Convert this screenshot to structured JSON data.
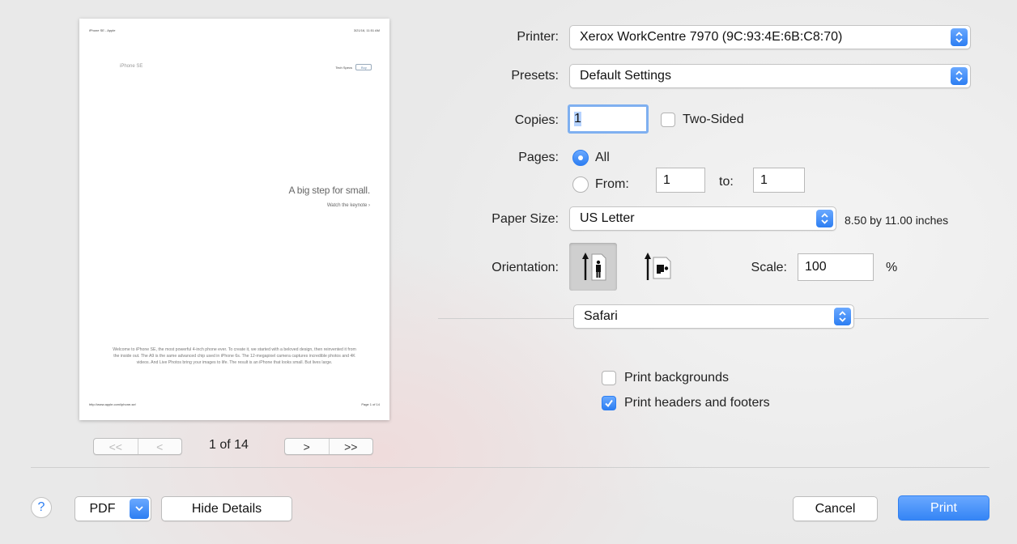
{
  "preview": {
    "header_left": "iPhone SE - Apple",
    "header_right": "3/21/16, 11:51 AM",
    "logo_text": "iPhone SE",
    "tech_specs": "Tech Specs",
    "buy_label": "Buy",
    "headline": "A big step for small.",
    "link": "Watch the keynote ›",
    "body": "Welcome to iPhone SE, the most powerful 4-inch phone ever. To create it, we started with a beloved design, then reinvented it from the inside out. The A9 is the same advanced chip used in iPhone 6s. The 12-megapixel camera captures incredible photos and 4K videos. And Live Photos bring your images to life. The result is an iPhone that looks small. But lives large.",
    "footer_left": "http://www.apple.com/iphone-se/",
    "footer_right": "Page 1 of 14"
  },
  "nav": {
    "first": "<<",
    "prev": "<",
    "next": ">",
    "last": ">>",
    "counter": "1 of 14"
  },
  "printer": {
    "label": "Printer:",
    "value": "Xerox WorkCentre 7970 (9C:93:4E:6B:C8:70)"
  },
  "presets": {
    "label": "Presets:",
    "value": "Default Settings"
  },
  "copies": {
    "label": "Copies:",
    "value": "1",
    "two_sided": "Two-Sided"
  },
  "pages": {
    "label": "Pages:",
    "all": "All",
    "from_label": "From:",
    "from_value": "1",
    "to_label": "to:",
    "to_value": "1"
  },
  "paper": {
    "label": "Paper Size:",
    "value": "US Letter",
    "dimensions": "8.50 by 11.00 inches"
  },
  "orientation": {
    "label": "Orientation:",
    "selected": "portrait"
  },
  "scale": {
    "label": "Scale:",
    "value": "100",
    "unit": "%"
  },
  "section": {
    "value": "Safari"
  },
  "options": {
    "backgrounds": "Print backgrounds",
    "backgrounds_checked": false,
    "headers_footers": "Print headers and footers",
    "headers_footers_checked": true
  },
  "buttons": {
    "help": "?",
    "pdf": "PDF",
    "hide_details": "Hide Details",
    "cancel": "Cancel",
    "print": "Print"
  },
  "colors": {
    "accent": "#2d7ef2",
    "background": "#e9e9e9"
  }
}
